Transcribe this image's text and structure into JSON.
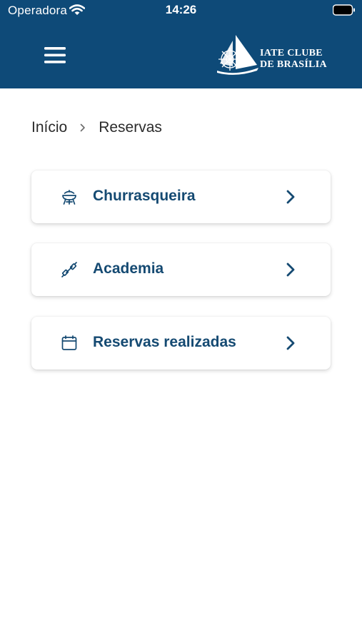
{
  "status_bar": {
    "carrier": "Operadora",
    "time": "14:26"
  },
  "header": {
    "logo": {
      "line1": "IATE CLUBE",
      "line2": "DE BRASÍLIA"
    },
    "menu_icon": "hamburger-menu-icon"
  },
  "breadcrumb": {
    "home": "Início",
    "current": "Reservas"
  },
  "menu_items": [
    {
      "label": "Churrasqueira",
      "icon": "barbecue-grill-icon"
    },
    {
      "label": "Academia",
      "icon": "dumbbell-icon"
    },
    {
      "label": "Reservas realizadas",
      "icon": "calendar-icon"
    }
  ],
  "colors": {
    "header_bg": "#0e4a78",
    "accent": "#154a72"
  }
}
